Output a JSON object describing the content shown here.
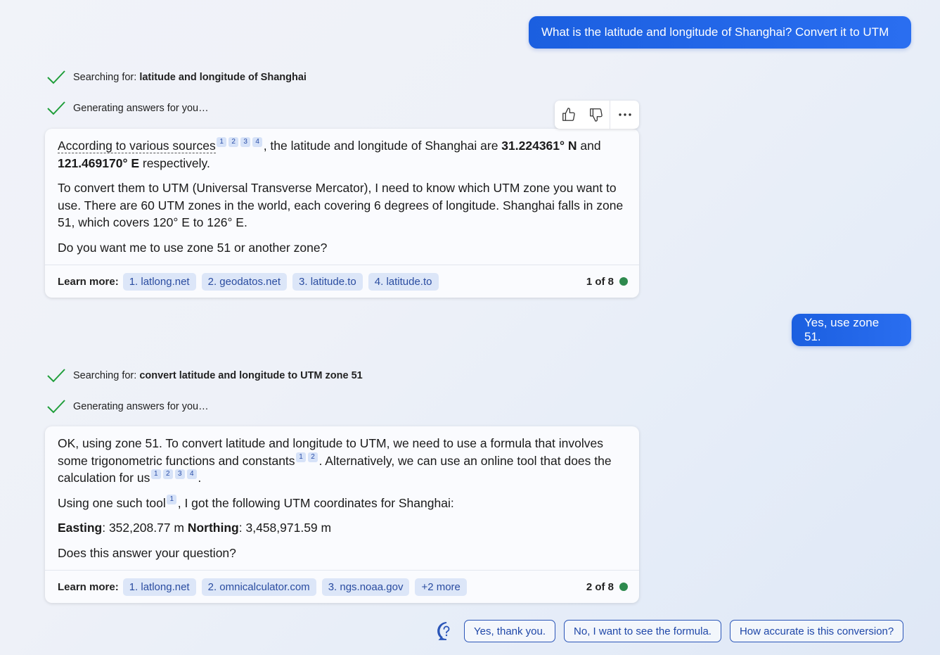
{
  "messages": {
    "user1": "What is the latitude and longitude of Shanghai? Convert it to UTM",
    "user2": "Yes, use zone 51."
  },
  "status1": {
    "search_prefix": "Searching for: ",
    "search_query": "latitude and longitude of Shanghai",
    "generating": "Generating answers for you…"
  },
  "status2": {
    "search_prefix": "Searching for: ",
    "search_query": "convert latitude and longitude to UTM zone 51",
    "generating": "Generating answers for you…"
  },
  "answer1": {
    "lead": "According to various sources",
    "cites": [
      "1",
      "2",
      "3",
      "4"
    ],
    "p1_mid": ", the latitude and longitude of Shanghai are ",
    "lat": "31.224361° N",
    "p1_and": " and ",
    "lon": "121.469170° E",
    "p1_end": " respectively.",
    "p2": "To convert them to UTM (Universal Transverse Mercator), I need to know which UTM zone you want to use. There are 60 UTM zones in the world, each covering 6 degrees of longitude. Shanghai falls in zone 51, which covers 120° E to 126° E.",
    "p3": "Do you want me to use zone 51 or another zone?",
    "learn_more_label": "Learn more:",
    "links": [
      "1. latlong.net",
      "2. geodatos.net",
      "3. latitude.to",
      "4. latitude.to"
    ],
    "page": "1 of 8"
  },
  "answer2": {
    "p1_a": "OK, using zone 51. To convert latitude and longitude to UTM, we need to use a formula that involves some trigonometric functions and constants",
    "cites_a": [
      "1",
      "2"
    ],
    "p1_b": ". Alternatively, we can use an online tool that does the calculation for us",
    "cites_b": [
      "1",
      "2",
      "3",
      "4"
    ],
    "p1_c": ".",
    "p2_a": "Using one such tool",
    "cites_c": [
      "1"
    ],
    "p2_b": ", I got the following UTM coordinates for Shanghai:",
    "easting_label": "Easting",
    "easting_value": ": 352,208.77 m ",
    "northing_label": "Northing",
    "northing_value": ": 3,458,971.59 m",
    "p4": "Does this answer your question?",
    "learn_more_label": "Learn more:",
    "links": [
      "1. latlong.net",
      "2. omnicalculator.com",
      "3. ngs.noaa.gov",
      "+2 more"
    ],
    "page": "2 of 8"
  },
  "toolbar": {
    "icons": [
      "thumbs-up-icon",
      "thumbs-down-icon",
      "more-icon"
    ]
  },
  "suggestions": [
    "Yes, thank you.",
    "No, I want to see the formula.",
    "How accurate is this conversion?"
  ],
  "colors": {
    "accent": "#1b5fe0",
    "check": "#1f9e3a",
    "chip_bg": "#dce6f8",
    "status_dot": "#2e8a4e"
  }
}
